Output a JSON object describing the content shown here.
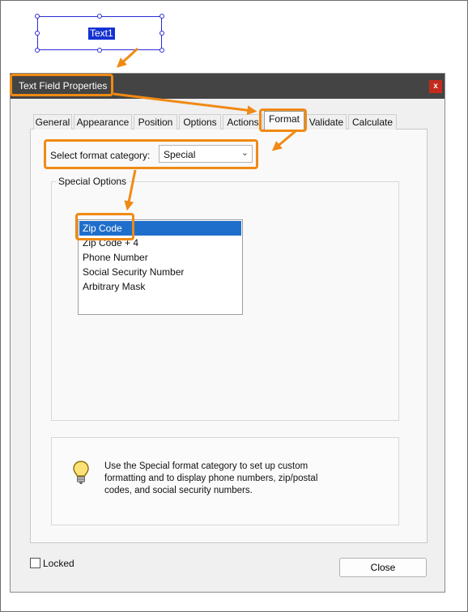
{
  "page_field": {
    "name": "Text1"
  },
  "dialog": {
    "title": "Text Field Properties",
    "close_glyph": "x",
    "tabs": [
      "General",
      "Appearance",
      "Position",
      "Options",
      "Actions",
      "Format",
      "Validate",
      "Calculate"
    ],
    "active_tab": "Format",
    "format_category": {
      "label": "Select format category:",
      "value": "Special"
    },
    "special_options": {
      "title": "Special Options",
      "items": [
        "Zip Code",
        "Zip Code + 4",
        "Phone Number",
        "Social Security Number",
        "Arbitrary Mask"
      ],
      "selected": "Zip Code"
    },
    "tip": {
      "icon": "lightbulb-icon",
      "text": "Use the Special format category to set up custom formatting and to display phone numbers, zip/postal codes, and social security numbers."
    },
    "locked_label": "Locked",
    "close_button": "Close"
  },
  "colors": {
    "annotation": "#f08a14",
    "titlebar": "#444444",
    "selection": "#1e6fcb",
    "field_outline": "#2a2ad6"
  }
}
